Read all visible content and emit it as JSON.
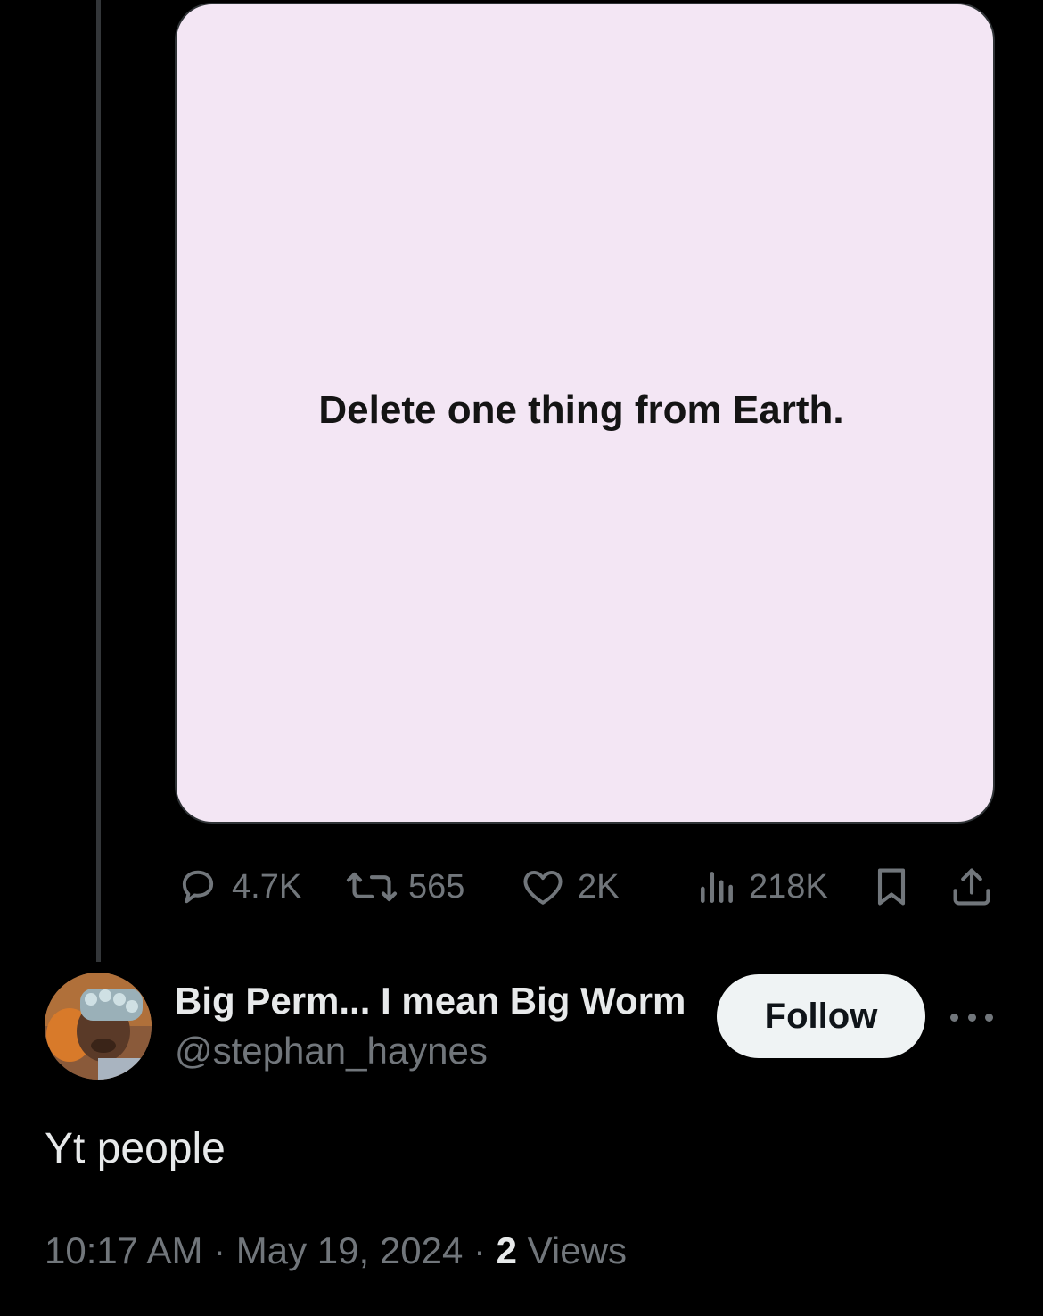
{
  "media": {
    "text": "Delete one thing from Earth."
  },
  "actions": {
    "replies": "4.7K",
    "reposts": "565",
    "likes": "2K",
    "views": "218K",
    "bookmark_icon": "bookmark-icon",
    "share_icon": "share-icon"
  },
  "author": {
    "display_name": "Big Perm... I mean Big Worm",
    "handle": "@stephan_haynes",
    "follow_label": "Follow",
    "more_icon": "more-icon"
  },
  "tweet": {
    "text": "Yt people",
    "time": "10:17 AM",
    "separator1": " · ",
    "date": "May 19, 2024",
    "separator2": " · ",
    "views_count": "2",
    "views_label": " Views"
  },
  "colors": {
    "background": "#000000",
    "text_primary": "#e7e9ea",
    "text_secondary": "#71767b",
    "media_background": "#f3e6f4",
    "follow_button": "#eff3f4",
    "thread_line": "#333639"
  }
}
